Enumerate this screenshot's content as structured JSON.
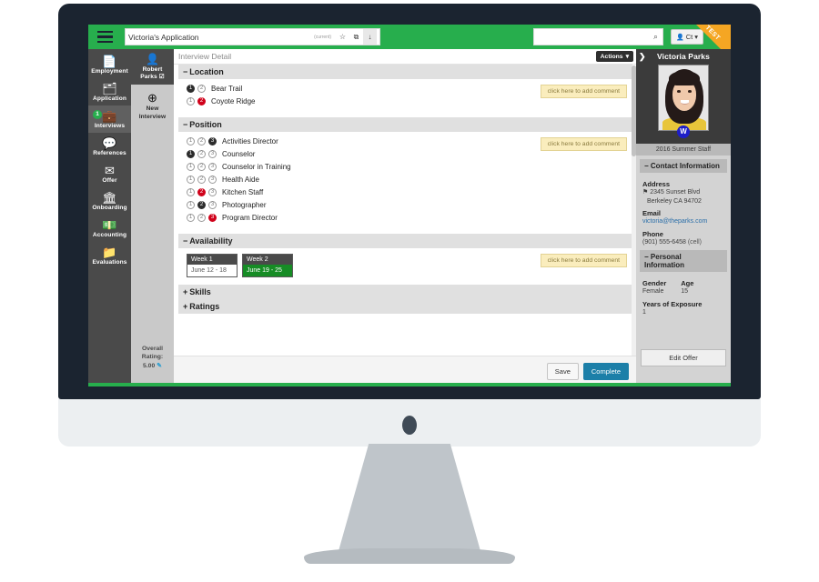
{
  "topbar": {
    "menu_icon": "hamburger-icon",
    "title_value": "Victoria's Application",
    "title_current_label": "(current)",
    "star_icon": "☆",
    "external_icon": "⧉",
    "download_icon": "↓",
    "search_placeholder": "",
    "search_value": "",
    "search_icon": "⌕",
    "user_icon": "⚫",
    "user_label": "Ct",
    "user_caret": "▾",
    "ribbon_label": "TEST",
    "green_color": "#27ae4d",
    "ribbon_color": "#f5a623"
  },
  "rail": {
    "items": [
      {
        "label": "Employment",
        "glyph": "Ὄ4",
        "icon": "document-icon",
        "badge": null,
        "active": false
      },
      {
        "label": "Application",
        "glyph": "▣",
        "icon": "inbox-icon",
        "badge": null,
        "active": false
      },
      {
        "label": "Interviews",
        "glyph": "ὋC",
        "icon": "briefcase-icon",
        "badge": "1",
        "active": true
      },
      {
        "label": "References",
        "glyph": "ὊC",
        "icon": "comment-icon",
        "badge": null,
        "active": false
      },
      {
        "label": "Offer",
        "glyph": "✉",
        "icon": "envelope-icon",
        "badge": null,
        "active": false
      },
      {
        "label": "Onboarding",
        "glyph": "ἽB",
        "icon": "bank-icon",
        "badge": null,
        "active": false
      },
      {
        "label": "Accounting",
        "glyph": "Ὃ5",
        "icon": "money-icon",
        "badge": null,
        "active": false
      },
      {
        "label": "Evaluations",
        "glyph": "Ὄ1",
        "icon": "folder-icon",
        "badge": null,
        "active": false
      }
    ]
  },
  "rail2": {
    "person_label": "Robert",
    "person_label2": "Parks",
    "person_check": "☑",
    "person_icon": "user-icon",
    "new_glyph": "⊕",
    "new_label": "New",
    "new_label2": "Interview",
    "overall_label": "Overall",
    "overall_label2": "Rating:",
    "overall_value": "5.00",
    "pencil_icon": "✎"
  },
  "main": {
    "detail_title": "Interview Detail",
    "actions_label": "Actions",
    "actions_caret": "▾",
    "comment_button_label": "click here to add comment",
    "sections": [
      {
        "name": "Location",
        "toggle": "−",
        "expanded": true,
        "options": [
          {
            "label": "Bear Trail",
            "circles": [
              {
                "n": "1",
                "state": "dark"
              },
              {
                "n": "2",
                "state": "off"
              }
            ]
          },
          {
            "label": "Coyote Ridge",
            "circles": [
              {
                "n": "1",
                "state": "off"
              },
              {
                "n": "2",
                "state": "red"
              }
            ]
          }
        ]
      },
      {
        "name": "Position",
        "toggle": "−",
        "expanded": true,
        "options": [
          {
            "label": "Activities Director",
            "circles": [
              {
                "n": "1",
                "state": "off"
              },
              {
                "n": "2",
                "state": "off"
              },
              {
                "n": "3",
                "state": "dark"
              }
            ]
          },
          {
            "label": "Counselor",
            "circles": [
              {
                "n": "1",
                "state": "dark"
              },
              {
                "n": "2",
                "state": "off"
              },
              {
                "n": "3",
                "state": "off"
              }
            ]
          },
          {
            "label": "Counselor in Training",
            "circles": [
              {
                "n": "1",
                "state": "off"
              },
              {
                "n": "2",
                "state": "off"
              },
              {
                "n": "3",
                "state": "off"
              }
            ]
          },
          {
            "label": "Health Aide",
            "circles": [
              {
                "n": "1",
                "state": "off"
              },
              {
                "n": "2",
                "state": "off"
              },
              {
                "n": "3",
                "state": "off"
              }
            ]
          },
          {
            "label": "Kitchen Staff",
            "circles": [
              {
                "n": "1",
                "state": "off"
              },
              {
                "n": "2",
                "state": "red"
              },
              {
                "n": "3",
                "state": "off"
              }
            ]
          },
          {
            "label": "Photographer",
            "circles": [
              {
                "n": "1",
                "state": "off"
              },
              {
                "n": "2",
                "state": "dark"
              },
              {
                "n": "3",
                "state": "off"
              }
            ]
          },
          {
            "label": "Program Director",
            "circles": [
              {
                "n": "1",
                "state": "off"
              },
              {
                "n": "2",
                "state": "off"
              },
              {
                "n": "3",
                "state": "red"
              }
            ]
          }
        ]
      },
      {
        "name": "Availability",
        "toggle": "−",
        "expanded": true,
        "weeks": [
          {
            "title": "Week 1",
            "range": "June 12 - 18",
            "selected": false
          },
          {
            "title": "Week 2",
            "range": "June 19 - 25",
            "selected": true
          }
        ]
      },
      {
        "name": "Skills",
        "toggle": "+",
        "expanded": false
      },
      {
        "name": "Ratings",
        "toggle": "+",
        "expanded": false
      }
    ],
    "save_label": "Save",
    "complete_label": "Complete"
  },
  "rpanel": {
    "collapse_icon": "❯",
    "name": "Victoria Parks",
    "badge_letter": "W",
    "subtitle": "2016 Summer Staff",
    "contact_section": "Contact Information",
    "contact_toggle": "−",
    "address_label": "Address",
    "address_pin": "⚑",
    "address_line1": "2345 Sunset Blvd",
    "address_line2": "Berkeley CA 94702",
    "email_label": "Email",
    "email_value": "victoria@theparks.com",
    "phone_label": "Phone",
    "phone_value": "(901) 555-6458",
    "phone_type": "(cell)",
    "personal_section": "Personal Information",
    "personal_toggle": "−",
    "gender_label": "Gender",
    "gender_value": "Female",
    "age_label": "Age",
    "age_value": "15",
    "exposure_label": "Years of Exposure",
    "exposure_value": "1",
    "edit_offer_label": "Edit Offer"
  }
}
